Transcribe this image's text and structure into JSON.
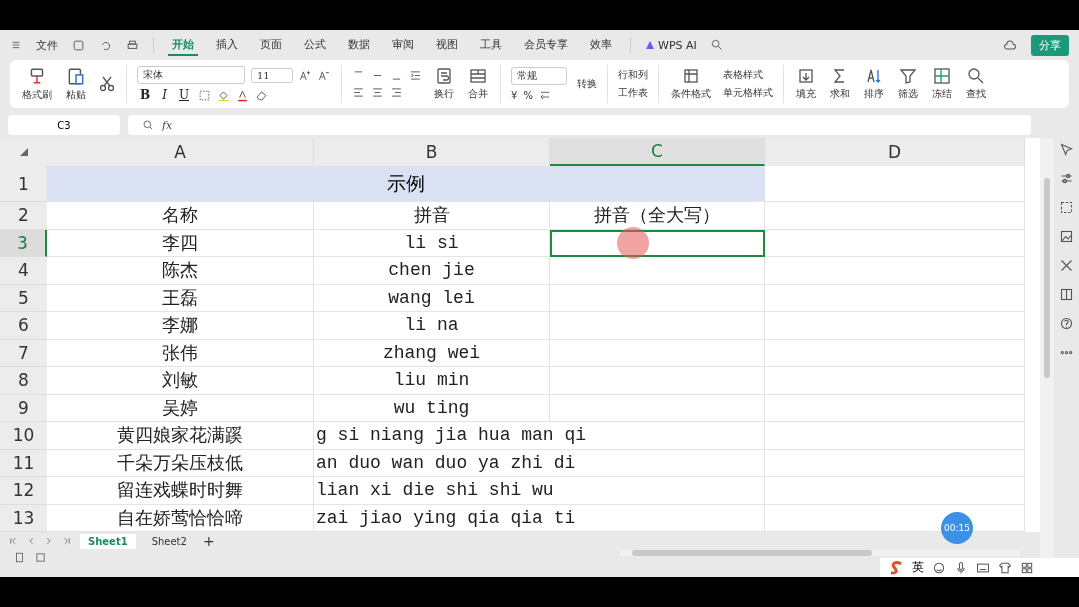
{
  "menu": {
    "file": "文件",
    "tabs": [
      {
        "label": "开始",
        "selected": true
      },
      {
        "label": "插入",
        "selected": false
      },
      {
        "label": "页面",
        "selected": false
      },
      {
        "label": "公式",
        "selected": false
      },
      {
        "label": "数据",
        "selected": false
      },
      {
        "label": "审阅",
        "selected": false
      },
      {
        "label": "视图",
        "selected": false
      },
      {
        "label": "工具",
        "selected": false
      },
      {
        "label": "会员专享",
        "selected": false
      },
      {
        "label": "效率",
        "selected": false
      }
    ],
    "ai": "WPS AI",
    "share": "分享"
  },
  "ribbon": {
    "left": [
      {
        "label": "格式刷",
        "kind": "brush"
      },
      {
        "label": "粘贴",
        "kind": "paste"
      }
    ],
    "font": "宋体",
    "size": "11",
    "styles": [
      "B",
      "I",
      "U"
    ],
    "wrap": [
      {
        "label": "换行",
        "kind": "wrap"
      },
      {
        "label": "合并",
        "kind": "merge"
      }
    ],
    "number_format": "常规",
    "currency": "¥",
    "percent": "%",
    "convert": "转换",
    "rowcol": "行和列",
    "sheet": "工作表",
    "cond": "条件格式",
    "table_style": "表格样式",
    "cell_style": "单元格样式",
    "tools": [
      {
        "label": "填充",
        "kind": "fill"
      },
      {
        "label": "求和",
        "kind": "sum"
      },
      {
        "label": "排序",
        "kind": "sort"
      },
      {
        "label": "筛选",
        "kind": "filter"
      },
      {
        "label": "冻结",
        "kind": "freeze"
      },
      {
        "label": "查找",
        "kind": "find"
      }
    ]
  },
  "formula_bar": {
    "cell": "C3",
    "fx": "fx"
  },
  "columns": [
    {
      "label": "A",
      "selected": false
    },
    {
      "label": "B",
      "selected": false
    },
    {
      "label": "C",
      "selected": true
    },
    {
      "label": "D",
      "selected": false
    }
  ],
  "rows": [
    {
      "number": "1",
      "selected": false,
      "merged": "示例"
    },
    {
      "number": "2",
      "selected": false,
      "cells": [
        "名称",
        "拼音",
        "拼音（全大写）"
      ]
    },
    {
      "number": "3",
      "selected": true,
      "cells": [
        "李四",
        "li si",
        ""
      ]
    },
    {
      "number": "4",
      "selected": false,
      "cells": [
        "陈杰",
        "chen jie",
        ""
      ]
    },
    {
      "number": "5",
      "selected": false,
      "cells": [
        "王磊",
        "wang lei",
        ""
      ]
    },
    {
      "number": "6",
      "selected": false,
      "cells": [
        "李娜",
        "li na",
        ""
      ]
    },
    {
      "number": "7",
      "selected": false,
      "cells": [
        "张伟",
        "zhang wei",
        ""
      ]
    },
    {
      "number": "8",
      "selected": false,
      "cells": [
        "刘敏",
        "liu min",
        ""
      ]
    },
    {
      "number": "9",
      "selected": false,
      "cells": [
        "吴婷",
        "wu ting",
        ""
      ]
    },
    {
      "number": "10",
      "selected": false,
      "overflow": true,
      "cells": [
        "黄四娘家花满蹊",
        "g si niang jia hua man qi",
        ""
      ]
    },
    {
      "number": "11",
      "selected": false,
      "overflow": true,
      "cells": [
        "千朵万朵压枝低",
        "an duo wan duo ya zhi di",
        ""
      ]
    },
    {
      "number": "12",
      "selected": false,
      "overflow": true,
      "cells": [
        "留连戏蝶时时舞",
        "lian xi die shi shi wu",
        ""
      ]
    },
    {
      "number": "13",
      "selected": false,
      "overflow": true,
      "cells": [
        "自在娇莺恰恰啼",
        "zai jiao ying qia qia ti",
        ""
      ]
    }
  ],
  "sheets": [
    {
      "label": "Sheet1",
      "selected": true
    },
    {
      "label": "Sheet2",
      "selected": false
    }
  ],
  "add_sheet": "+",
  "timer": "00:15",
  "ime": "英"
}
